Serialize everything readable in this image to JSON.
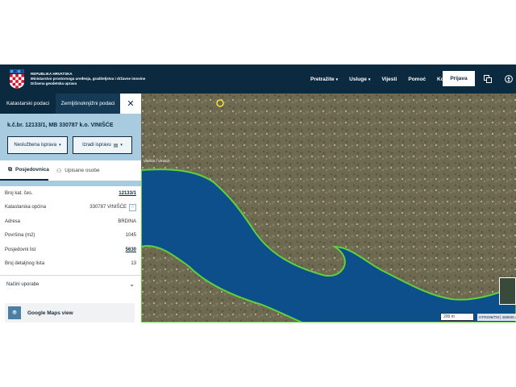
{
  "header": {
    "brand_line1": "REPUBLIKA HRVATSKA",
    "brand_line2": "Ministarstvo prostornoga uređenja, graditeljstva i državne imovine",
    "brand_line3": "Državna geodetska uprava",
    "nav": [
      {
        "label": "Pretražite",
        "caret": "▾"
      },
      {
        "label": "Usluge",
        "caret": "▾"
      },
      {
        "label": "Vijesti",
        "caret": ""
      },
      {
        "label": "Pomoć",
        "caret": ""
      },
      {
        "label": "Kontakt",
        "caret": ""
      }
    ],
    "login_label": "Prijava"
  },
  "sidebar": {
    "tabs": {
      "cadastral": "Katastarski podaci",
      "land_registry": "Zemljišnoknjižni podaci",
      "close": "✕"
    },
    "parcel_title": "k.č.br. 12133/1, MB 330787 k.o. VINIŠĆE",
    "btn_unofficial": "Neslužbena isprava",
    "btn_create": "Izradi ispravu",
    "subtabs": {
      "possession": "Posjedovnica",
      "registered": "Upisane osobe"
    },
    "info": [
      {
        "label": "Broj kat. čes.",
        "value": "12133/1",
        "link": true
      },
      {
        "label": "Katastarska općina",
        "value": "330787 VINIŠĆE",
        "link": false,
        "star": true
      },
      {
        "label": "Adresa",
        "value": "BRDINA",
        "link": false
      },
      {
        "label": "Površina (m2)",
        "value": "1045",
        "link": false
      },
      {
        "label": "Posjedovni list",
        "value": "5630",
        "link": true
      },
      {
        "label": "Broj detaljnog lista",
        "value": "13",
        "link": false
      }
    ],
    "usage_label": "Načini uporabe",
    "gmaps_label": "Google Maps view"
  },
  "map": {
    "place_label": "Vinišće / Vinisce",
    "scale_label": "200 m",
    "coords_label": "HTRS96/TM | 468836.2",
    "colors": {
      "sea": "#0d4f8a",
      "coast": "#5fd13a",
      "land": "#6f6a55"
    }
  }
}
